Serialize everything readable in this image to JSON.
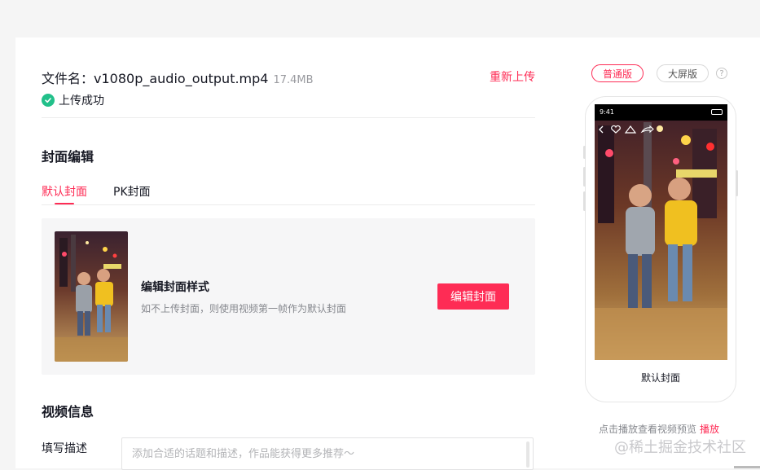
{
  "file": {
    "label": "文件名：",
    "name": "v1080p_audio_output.mp4",
    "size": "17.4MB",
    "reupload": "重新上传",
    "status": "上传成功"
  },
  "cover": {
    "section_title": "封面编辑",
    "tabs": [
      {
        "label": "默认封面",
        "active": true
      },
      {
        "label": "PK封面",
        "active": false
      }
    ],
    "style_title": "编辑封面样式",
    "style_hint": "如不上传封面，则使用视频第一帧作为默认封面",
    "edit_button": "编辑封面"
  },
  "video_info": {
    "section_title": "视频信息",
    "desc_label": "填写描述",
    "desc_placeholder": "添加合适的话题和描述，作品能获得更多推荐～"
  },
  "preview": {
    "mode_normal": "普通版",
    "mode_large": "大屏版",
    "help": "?",
    "status_time": "9:41",
    "phone_caption": "默认封面",
    "hint": "点击播放查看视频预览",
    "play": "播放"
  },
  "watermark": "@稀土掘金技术社区",
  "colors": {
    "accent": "#fe2c55",
    "success": "#22c08a"
  }
}
